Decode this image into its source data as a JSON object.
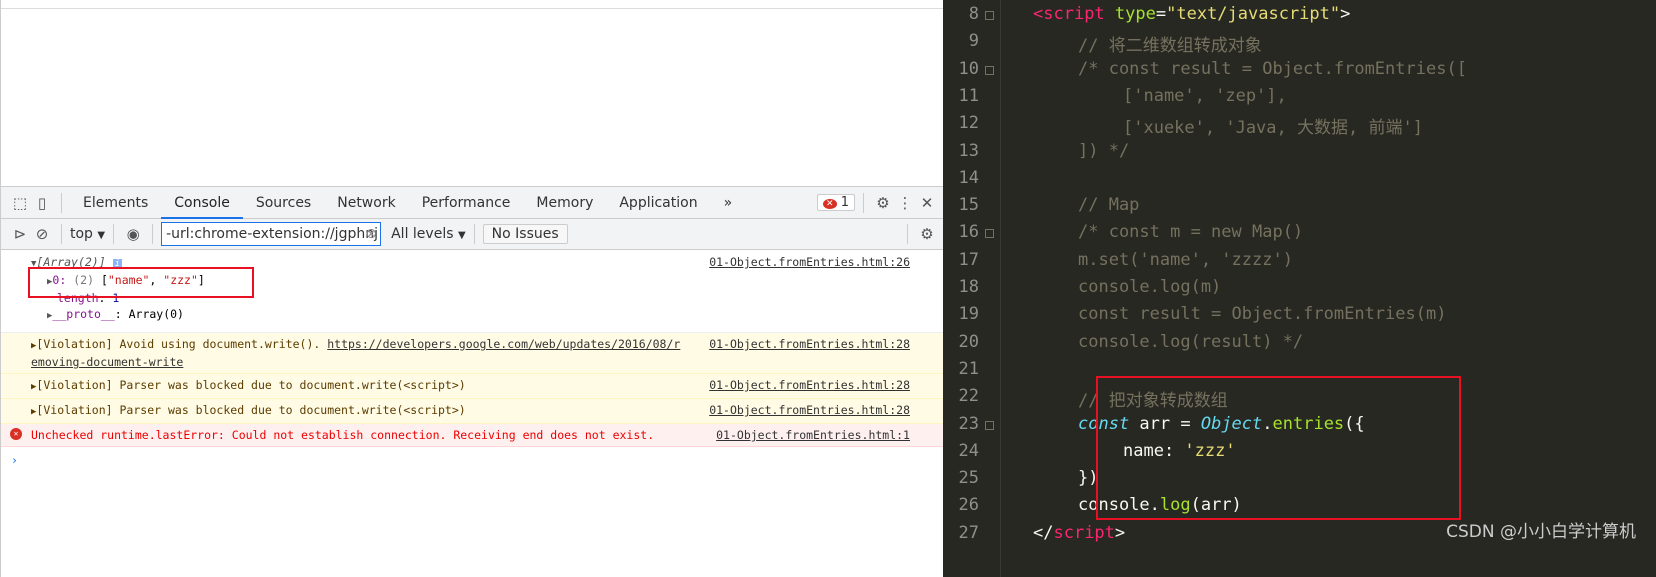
{
  "devtools": {
    "tabs": [
      "Elements",
      "Console",
      "Sources",
      "Network",
      "Performance",
      "Memory",
      "Application"
    ],
    "active_tab": "Console",
    "more": "»",
    "error_count": "1",
    "context": "top",
    "filter_value": "-url:chrome-extension://jgphnj",
    "levels": "All levels",
    "issues": "No Issues"
  },
  "console": {
    "array_header": "[Array(2)]",
    "array_item_key": "0:",
    "array_item_len": "(2)",
    "array_item_open": "[",
    "array_item_v1": "\"name\"",
    "array_item_v2": "\"zzz\"",
    "array_item_close": "]",
    "length_key": "length",
    "length_val": "1",
    "proto_key": "__proto__",
    "proto_val": "Array(0)",
    "array_src": "01-Object.fromEntries.html:26",
    "messages": [
      {
        "type": "warning",
        "text": "[Violation] Avoid using document.write(). ",
        "link": "https://developers.google.com/web/updates/2016/08/removing-document-write",
        "src": "01-Object.fromEntries.html:28"
      },
      {
        "type": "warning",
        "text": "[Violation] Parser was blocked due to document.write(<script>)",
        "src": "01-Object.fromEntries.html:28"
      },
      {
        "type": "warning",
        "text": "[Violation] Parser was blocked due to document.write(<script>)",
        "src": "01-Object.fromEntries.html:28"
      },
      {
        "type": "error",
        "text": "Unchecked runtime.lastError: Could not establish connection. Receiving end does not exist.",
        "src": "01-Object.fromEntries.html:1"
      }
    ],
    "prompt": "›"
  },
  "editor": {
    "lines": [
      {
        "n": "8",
        "fold": true,
        "indent": 2,
        "html": "<span class='tg'>&lt;</span><span class='tg'>script</span> <span class='at'>type</span>=<span class='st'>\"text/javascript\"</span>&gt;"
      },
      {
        "n": "9",
        "indent": 4,
        "html": "<span class='cm'>// 将二维数组转成对象</span>"
      },
      {
        "n": "10",
        "fold": true,
        "indent": 4,
        "html": "<span class='cm'>/* const result = Object.fromEntries([</span>"
      },
      {
        "n": "11",
        "indent": 6,
        "html": "<span class='cm'>['name', 'zep'],</span>"
      },
      {
        "n": "12",
        "indent": 6,
        "html": "<span class='cm'>['xueke', 'Java, 大数据, 前端']</span>"
      },
      {
        "n": "13",
        "indent": 4,
        "html": "<span class='cm'>]) */</span>"
      },
      {
        "n": "14",
        "indent": 4,
        "html": ""
      },
      {
        "n": "15",
        "indent": 4,
        "html": "<span class='cm'>// Map</span>"
      },
      {
        "n": "16",
        "fold": true,
        "indent": 4,
        "html": "<span class='cm'>/* const m = new Map()</span>"
      },
      {
        "n": "17",
        "indent": 4,
        "html": "<span class='cm'>m.set('name', 'zzzz')</span>"
      },
      {
        "n": "18",
        "indent": 4,
        "html": "<span class='cm'>console.log(m)</span>"
      },
      {
        "n": "19",
        "indent": 4,
        "html": "<span class='cm'>const result = Object.fromEntries(m)</span>"
      },
      {
        "n": "20",
        "indent": 4,
        "html": "<span class='cm'>console.log(result) */</span>"
      },
      {
        "n": "21",
        "indent": 4,
        "html": ""
      },
      {
        "n": "22",
        "indent": 4,
        "html": "<span class='cm'>// 把对象转成数组</span>"
      },
      {
        "n": "23",
        "fold": true,
        "indent": 4,
        "html": "<span class='kw'>const</span> arr = <span class='kw'>Object</span>.<span class='fn'>entries</span>({"
      },
      {
        "n": "24",
        "indent": 6,
        "html": "name: <span class='st'>'zzz'</span>"
      },
      {
        "n": "25",
        "indent": 4,
        "html": "})"
      },
      {
        "n": "26",
        "indent": 4,
        "html": "console.<span class='fn'>log</span>(arr)"
      },
      {
        "n": "27",
        "indent": 2,
        "html": "&lt;/<span class='tg'>script</span>&gt;"
      }
    ]
  },
  "watermark": "CSDN @小小白学计算机"
}
